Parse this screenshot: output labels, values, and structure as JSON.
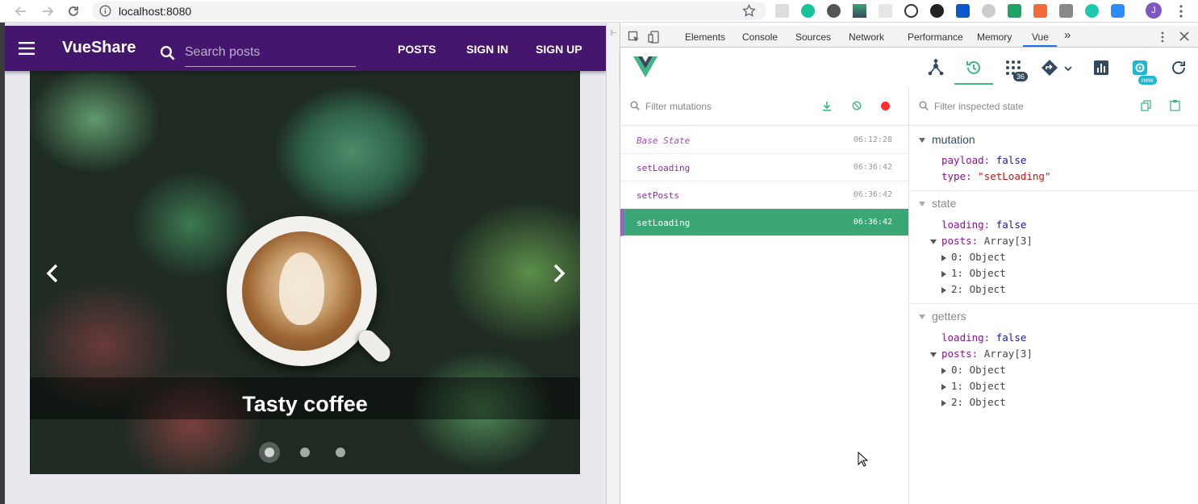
{
  "browser": {
    "url": "localhost:8080"
  },
  "app": {
    "brand": "VueShare",
    "search_placeholder": "Search posts",
    "nav": [
      "POSTS",
      "SIGN IN",
      "SIGN UP"
    ],
    "carousel": {
      "caption": "Tasty coffee",
      "slide_count": 3,
      "active_slide": 1
    },
    "colors": {
      "toolbar": "#44166e"
    }
  },
  "devtools": {
    "tabs": [
      "Elements",
      "Console",
      "Sources",
      "Network",
      "Performance",
      "Memory",
      "Vue"
    ],
    "active_tab": "Vue",
    "events_badge": "36",
    "new_badge": "new",
    "mutations": {
      "filter_placeholder": "Filter mutations",
      "items": [
        {
          "name": "Base State",
          "time": "06:12:28"
        },
        {
          "name": "setLoading",
          "time": "06:36:42"
        },
        {
          "name": "setPosts",
          "time": "06:36:42"
        },
        {
          "name": "setLoading",
          "time": "06:36:42"
        }
      ],
      "selected_index": 3,
      "selected_color": "#3ba776"
    },
    "inspector": {
      "filter_placeholder": "Filter inspected state",
      "mutation": {
        "title": "mutation",
        "payload_key": "payload:",
        "payload_value": "false",
        "type_key": "type:",
        "type_value": "\"setLoading\""
      },
      "state": {
        "title": "state",
        "loading_key": "loading:",
        "loading_value": "false",
        "posts_key": "posts:",
        "posts_value": "Array[3]",
        "items": [
          "0: Object",
          "1: Object",
          "2: Object"
        ]
      },
      "getters": {
        "title": "getters",
        "loading_key": "loading:",
        "loading_value": "false",
        "posts_key": "posts:",
        "posts_value": "Array[3]",
        "items": [
          "0: Object",
          "1: Object",
          "2: Object"
        ]
      }
    }
  }
}
